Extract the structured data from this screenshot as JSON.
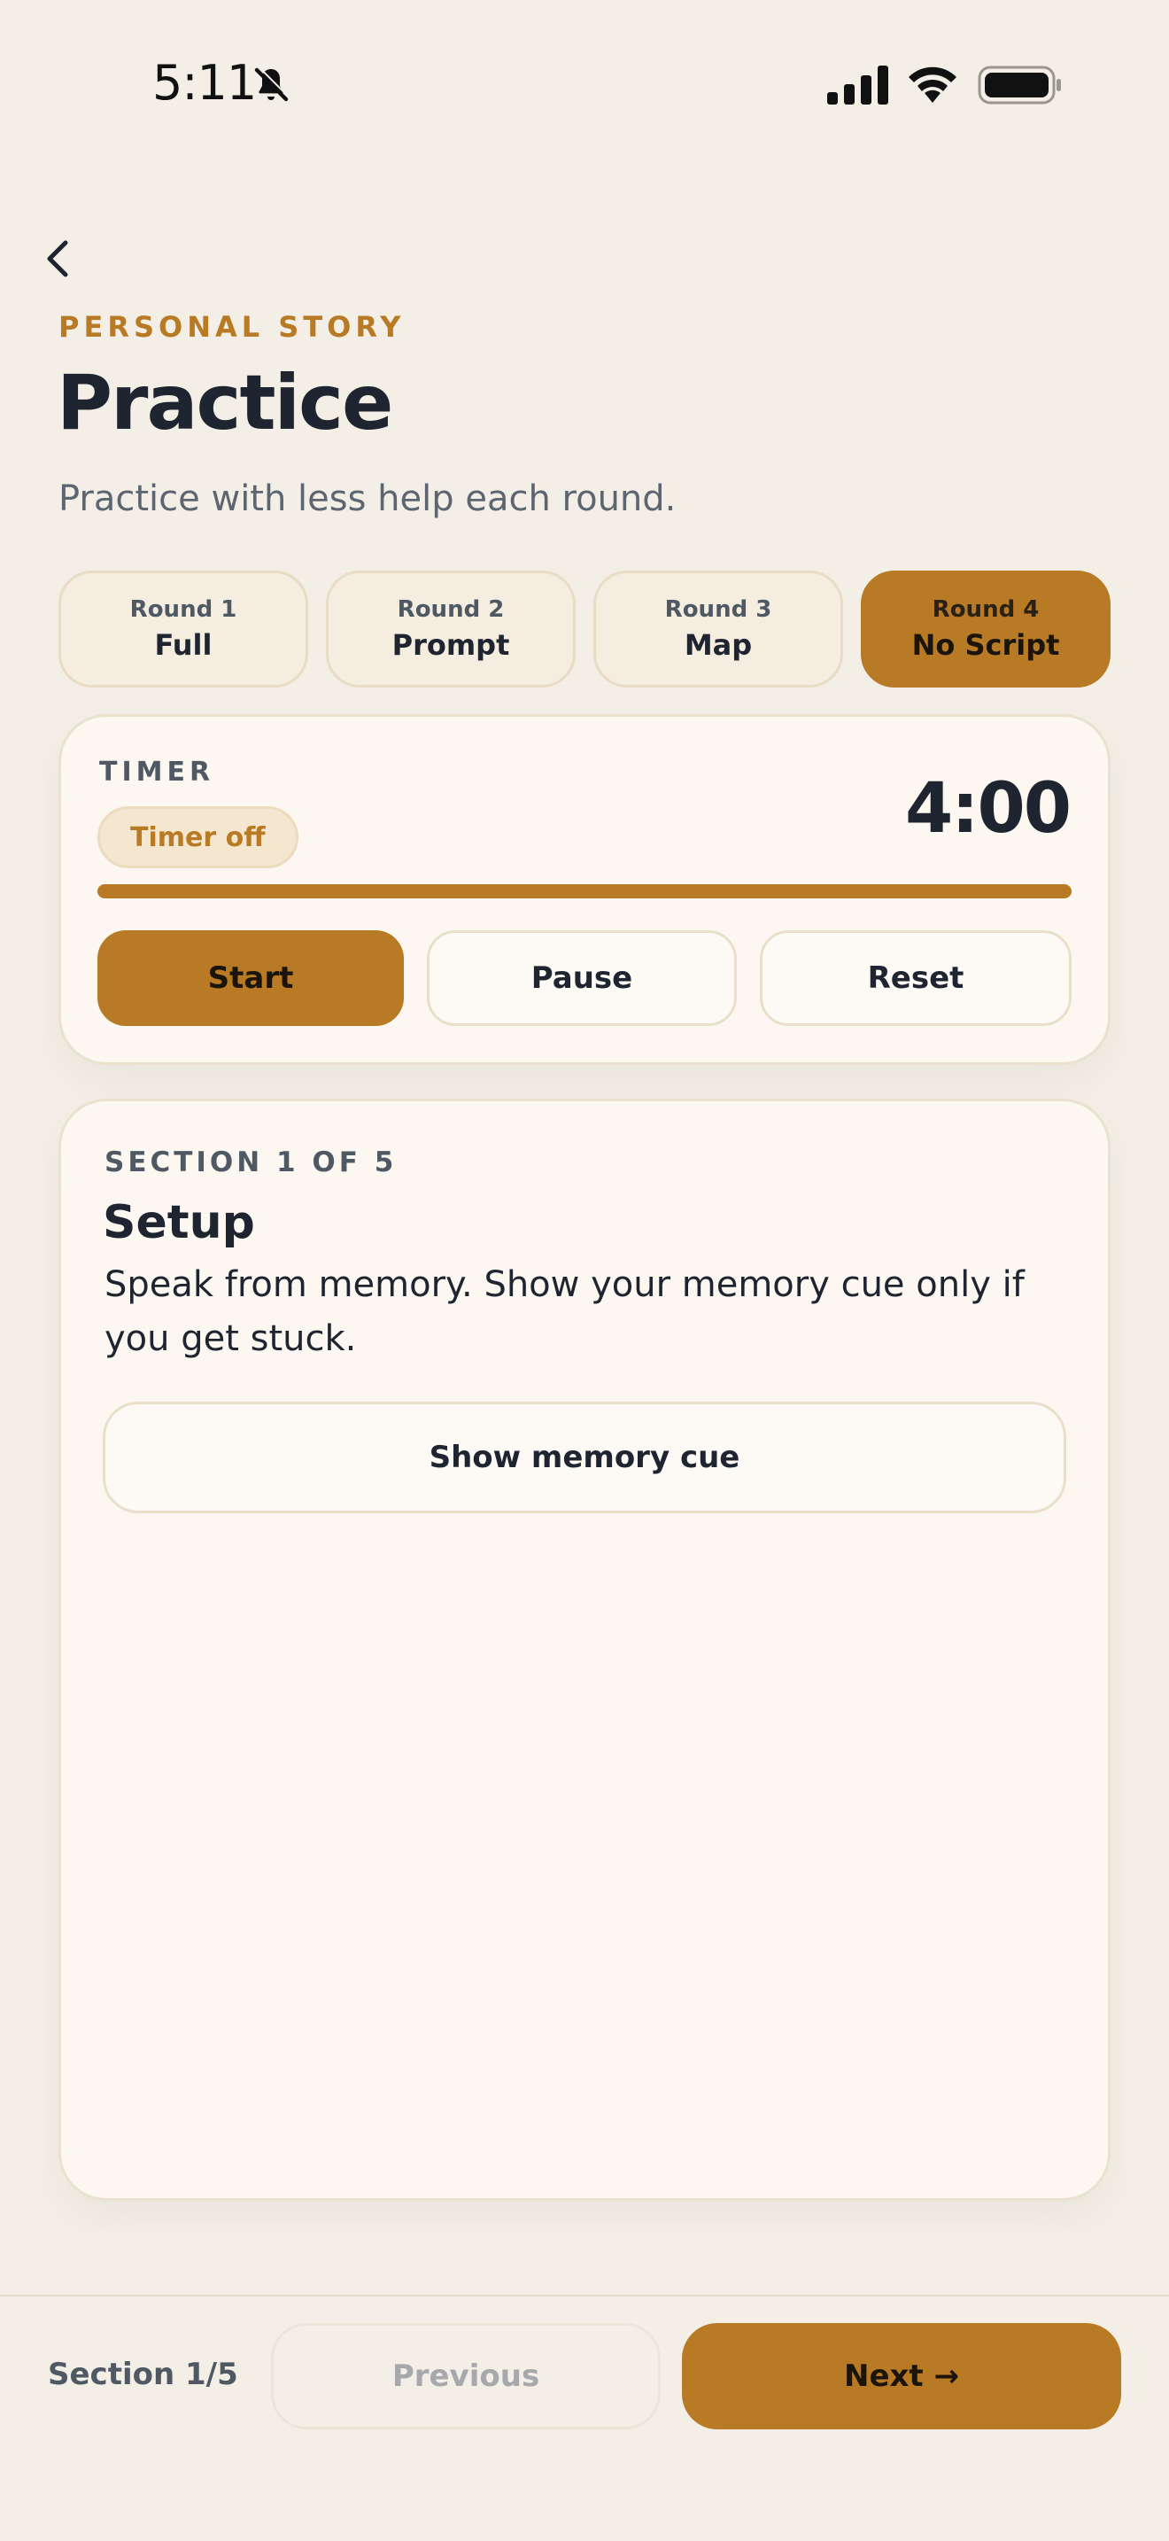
{
  "status_bar": {
    "time": "5:11"
  },
  "header": {
    "eyebrow": "PERSONAL STORY",
    "title": "Practice",
    "subtitle": "Practice with less help each round."
  },
  "rounds": [
    {
      "label": "Round 1",
      "name": "Full",
      "active": false
    },
    {
      "label": "Round 2",
      "name": "Prompt",
      "active": false
    },
    {
      "label": "Round 3",
      "name": "Map",
      "active": false
    },
    {
      "label": "Round 4",
      "name": "No Script",
      "active": true
    }
  ],
  "timer": {
    "label": "TIMER",
    "status": "Timer off",
    "value": "4:00",
    "progress": 1.0,
    "start_label": "Start",
    "pause_label": "Pause",
    "reset_label": "Reset"
  },
  "section": {
    "label": "SECTION 1 OF 5",
    "title": "Setup",
    "body": "Speak from memory. Show your memory cue only if you get stuck.",
    "cue_button": "Show memory cue"
  },
  "footer": {
    "label": "Section 1/5",
    "previous_label": "Previous",
    "next_label": "Next →"
  },
  "colors": {
    "accent": "#b87a24",
    "background": "#f3efe6",
    "card": "#fcf7f1",
    "text": "#1e2530",
    "muted": "#4f5964"
  },
  "icons": {
    "bell": "bell-slash-icon",
    "signal": "cellular-signal-icon",
    "wifi": "wifi-icon",
    "battery": "battery-icon",
    "back": "chevron-left-icon"
  }
}
